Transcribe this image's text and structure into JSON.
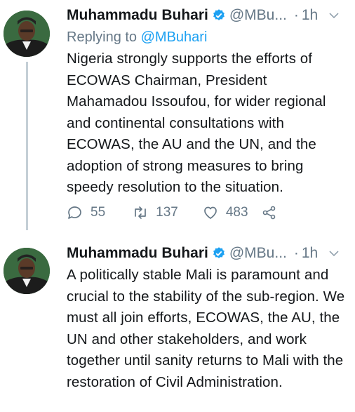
{
  "tweets": [
    {
      "author_name": "Muhammadu Buhari",
      "handle": "@MBu...",
      "dot": "·",
      "time": "1h",
      "reply_prefix": "Replying to",
      "reply_handle": "@MBuhari",
      "text": "Nigeria strongly supports the efforts of ECOWAS Chairman, President Mahamadou Issoufou, for wider regional and continental consultations with ECOWAS, the AU and the UN, and the adoption of strong measures to bring speedy resolution to the situation.",
      "replies": "55",
      "retweets": "137",
      "likes": "483"
    },
    {
      "author_name": "Muhammadu Buhari",
      "handle": "@MBu...",
      "dot": "·",
      "time": "1h",
      "text": "A politically stable Mali is paramount and crucial to the stability of the sub-region. We must all join efforts, ECOWAS, the AU, the UN and other stakeholders, and work together until sanity returns to Mali with the restoration of Civil Administration."
    }
  ],
  "icons": {
    "verified": "verified-badge-icon",
    "chevron": "chevron-down-icon",
    "reply": "reply-icon",
    "retweet": "retweet-icon",
    "like": "heart-icon",
    "share": "share-icon"
  },
  "colors": {
    "accent": "#1da1f2",
    "secondary_text": "#657786",
    "primary_text": "#14171a",
    "thread_line": "#c4cfd6"
  }
}
